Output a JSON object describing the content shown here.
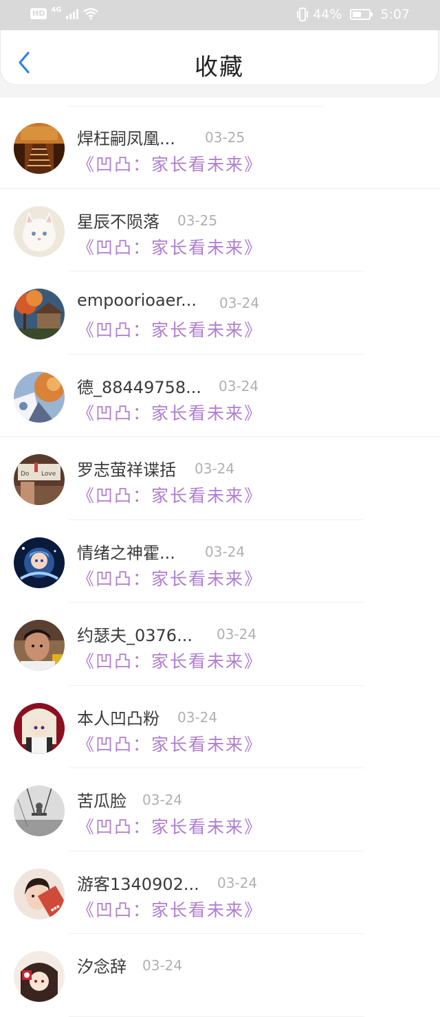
{
  "status_bar": {
    "hd": "HD",
    "network": "4G",
    "battery_percent": "44%",
    "time": "5:07"
  },
  "header": {
    "title": "收藏",
    "back_icon": "chevron-left-icon"
  },
  "colors": {
    "accent": "#2f80ed",
    "book_link": "#b07ed0"
  },
  "favorites": [
    {
      "name": "焊枉嗣凤凰...",
      "date": "03-25",
      "book": "《凹凸：家长看未来》",
      "avatar": "forest-bridge"
    },
    {
      "name": "星辰不陨落",
      "date": "03-25",
      "book": "《凹凸：家长看未来》",
      "avatar": "white-cat"
    },
    {
      "name": "empoorioaer...",
      "date": "03-24",
      "book": "《凹凸：家长看未来》",
      "avatar": "autumn-house"
    },
    {
      "name": "德_88449758...",
      "date": "03-24",
      "book": "《凹凸：家长看未来》",
      "avatar": "fantasy-art"
    },
    {
      "name": "罗志萤祥谍括",
      "date": "03-24",
      "book": "《凹凸：家长看未来》",
      "avatar": "love-photo"
    },
    {
      "name": "情绪之神霍...",
      "date": "03-24",
      "book": "《凹凸：家长看未来》",
      "avatar": "anime-blue"
    },
    {
      "name": "约瑟夫_0376...",
      "date": "03-24",
      "book": "《凹凸：家长看未来》",
      "avatar": "boy-photo"
    },
    {
      "name": "本人凹凸粉",
      "date": "03-24",
      "book": "《凹凸：家长看未来》",
      "avatar": "anime-girl"
    },
    {
      "name": "苦瓜脸",
      "date": "03-24",
      "book": "《凹凸：家长看未来》",
      "avatar": "swing-bw"
    },
    {
      "name": "游客1340902...",
      "date": "03-24",
      "book": "《凹凸：家长看未来》",
      "avatar": "girl-photo"
    },
    {
      "name": "汐念辞",
      "date": "03-24",
      "book": "",
      "avatar": "anime-red"
    }
  ]
}
